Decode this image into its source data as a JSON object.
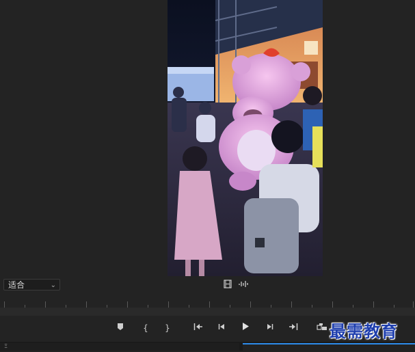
{
  "monitor": {
    "fit_value": "适合"
  },
  "timeline_ruler": {
    "label": ""
  },
  "controls": {
    "icons": [
      "marker-icon",
      "mark-in-icon",
      "mark-out-icon",
      "go-to-in-icon",
      "step-back-icon",
      "play-icon",
      "step-forward-icon",
      "go-to-out-icon",
      "insert-icon"
    ]
  },
  "bottom_panel": {
    "label": "Ξ"
  },
  "watermark": {
    "text": "最需教育"
  },
  "colors": {
    "accent": "#2d8ceb",
    "watermark": "#1f3fae"
  }
}
